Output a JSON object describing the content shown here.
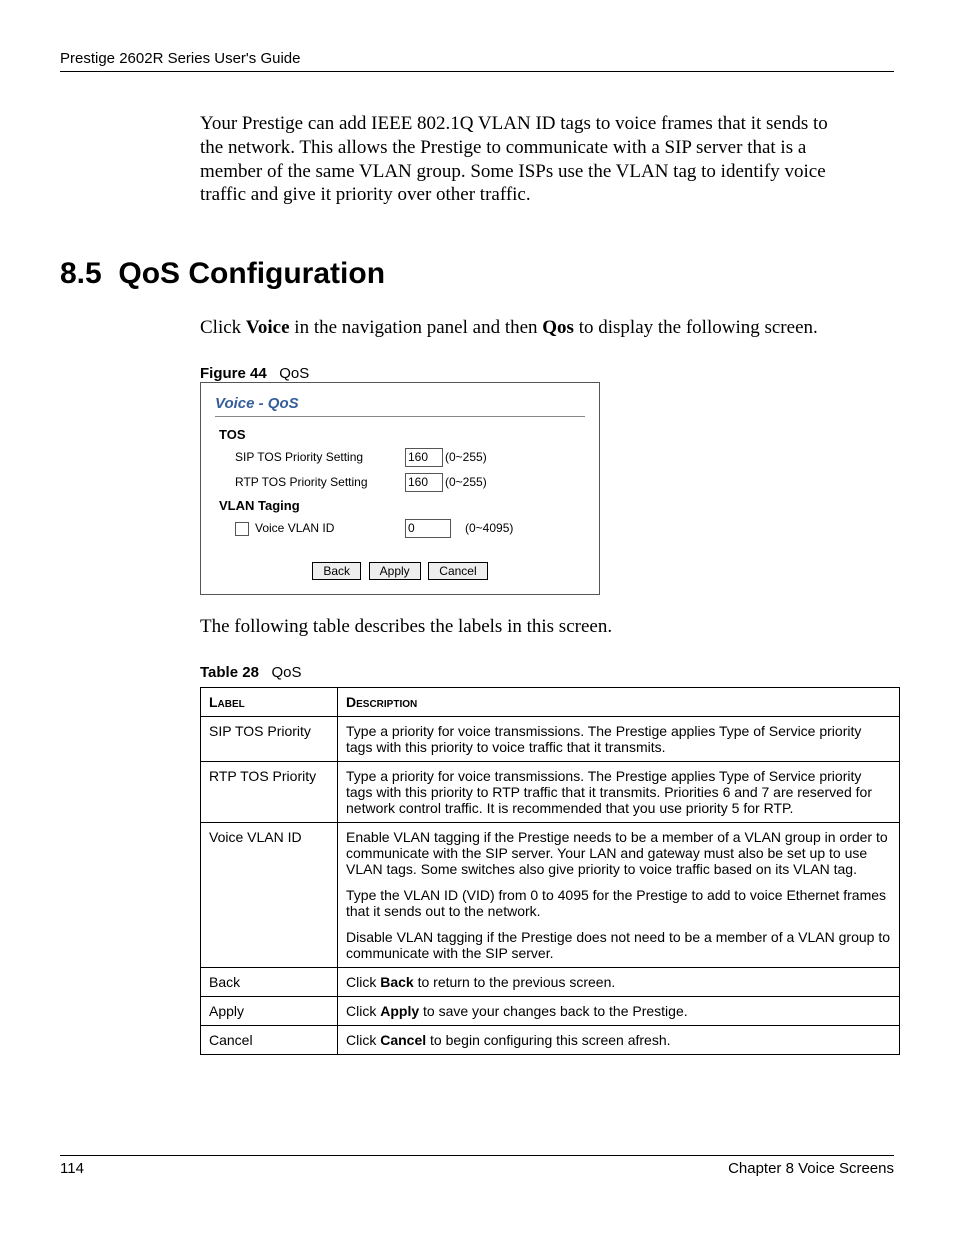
{
  "header": "Prestige 2602R Series User's Guide",
  "intro": "Your Prestige can add IEEE 802.1Q VLAN ID tags to voice frames that it sends to the network. This allows the Prestige to communicate with a SIP server that is a member of the same VLAN group. Some ISPs use the VLAN tag to identify voice traffic and give it priority over other traffic.",
  "section_no": "8.5",
  "section_title": "QoS Configuration",
  "click_pre": "Click ",
  "click_voice": "Voice",
  "click_mid": " in the navigation panel and then ",
  "click_qos": "Qos",
  "click_post": " to display the following screen.",
  "fig_prefix": "Figure 44",
  "fig_name": "QoS",
  "shot": {
    "breadcrumb": "Voice - QoS",
    "sec1": "TOS",
    "row1": "SIP TOS Priority Setting",
    "row1v": "160",
    "row1r": "(0~255)",
    "row2": "RTP TOS Priority Setting",
    "row2v": "160",
    "row2r": "(0~255)",
    "sec2": "VLAN Taging",
    "row3": "Voice VLAN ID",
    "row3v": "0",
    "row3r": "(0~4095)",
    "back": "Back",
    "apply": "Apply",
    "cancel": "Cancel"
  },
  "after_shot": "The following table describes the labels in this screen.",
  "tbl_prefix": "Table 28",
  "tbl_name": "QoS",
  "th_label": "Label",
  "th_desc": "Description",
  "rows": {
    "r1l": "SIP TOS Priority",
    "r1d": "Type a priority for voice transmissions. The Prestige applies Type of Service priority tags with this priority to voice traffic that it transmits.",
    "r2l": "RTP TOS Priority",
    "r2d": "Type a priority for voice transmissions. The Prestige applies Type of Service priority tags with this priority to RTP traffic that it transmits. Priorities 6 and 7 are reserved for network control traffic. It is recommended that you use priority 5 for RTP.",
    "r3l": "Voice VLAN ID",
    "r3d1": "Enable VLAN tagging if the Prestige needs to be a member of a VLAN group in order to communicate with the SIP server. Your LAN and gateway must also be set up to use VLAN tags. Some switches also give priority to voice traffic based on its VLAN tag.",
    "r3d2": "Type the VLAN ID (VID) from 0 to 4095 for the Prestige to add to voice Ethernet frames that it sends out to the network.",
    "r3d3": "Disable VLAN tagging if the Prestige does not need to be a member of a VLAN group to communicate with the SIP server.",
    "r4l": "Back",
    "r4d_pre": "Click ",
    "r4d_b": "Back",
    "r4d_post": " to return to the previous screen.",
    "r5l": "Apply",
    "r5d_pre": "Click ",
    "r5d_b": "Apply",
    "r5d_post": " to save your changes back to the Prestige.",
    "r6l": "Cancel",
    "r6d_pre": "Click ",
    "r6d_b": "Cancel",
    "r6d_post": " to begin configuring this screen afresh."
  },
  "footer_page": "114",
  "footer_chapter": "Chapter 8 Voice Screens"
}
